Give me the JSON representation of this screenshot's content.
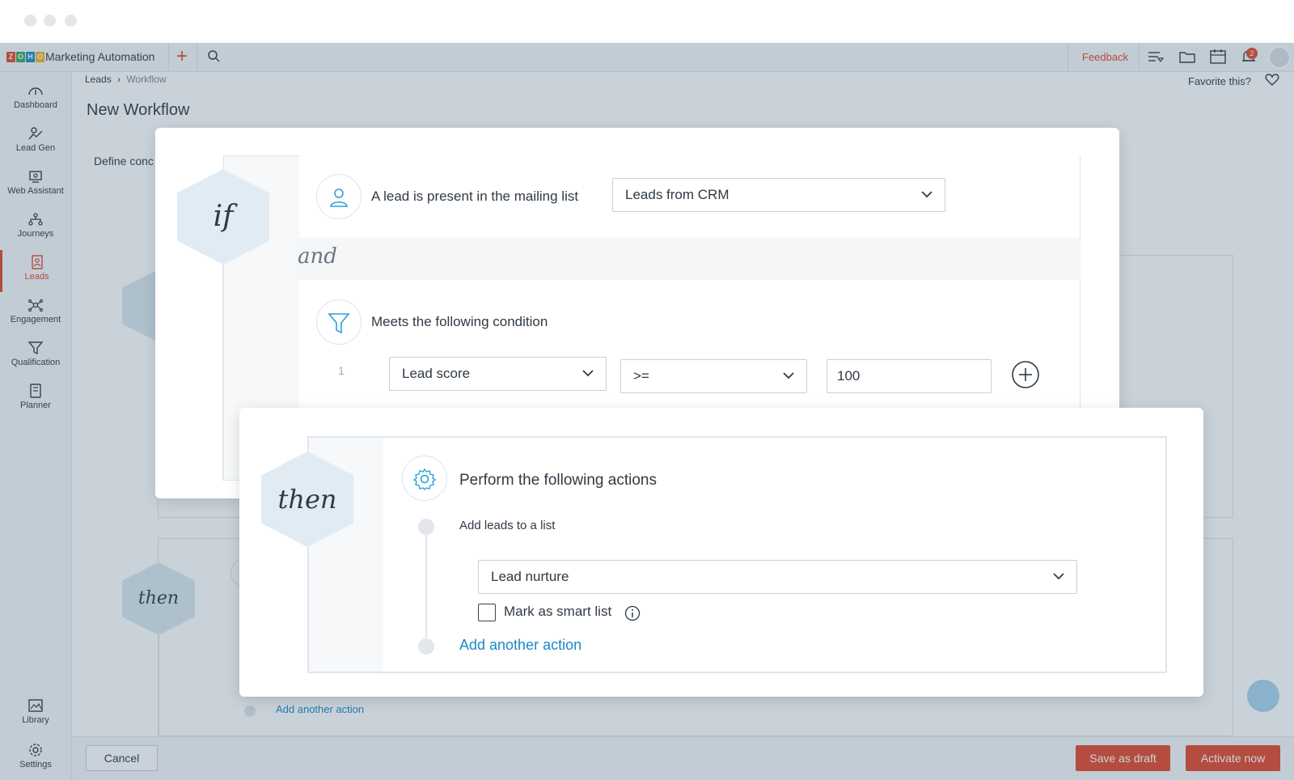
{
  "app": {
    "title": "Marketing Automation",
    "logo_letters": [
      "Z",
      "O",
      "H",
      "O"
    ]
  },
  "topbar": {
    "feedback": "Feedback",
    "notification_count": "2"
  },
  "sidebar": {
    "items": [
      {
        "label": "Dashboard",
        "icon": "dashboard-icon"
      },
      {
        "label": "Lead Gen",
        "icon": "lead-gen-icon"
      },
      {
        "label": "Web Assistant",
        "icon": "web-assistant-icon"
      },
      {
        "label": "Journeys",
        "icon": "journeys-icon"
      },
      {
        "label": "Leads",
        "icon": "leads-icon",
        "active": true
      },
      {
        "label": "Engagement",
        "icon": "engagement-icon"
      },
      {
        "label": "Qualification",
        "icon": "qualification-icon"
      },
      {
        "label": "Planner",
        "icon": "planner-icon"
      }
    ],
    "bottom": [
      {
        "label": "Library",
        "icon": "library-icon"
      },
      {
        "label": "Settings",
        "icon": "settings-icon"
      }
    ]
  },
  "breadcrumb": {
    "parent": "Leads",
    "separator": "›",
    "current": "Workflow"
  },
  "favorite": {
    "label": "Favorite this?"
  },
  "page": {
    "title": "New Workflow",
    "define_text": "Define conc"
  },
  "background": {
    "then_label": "then",
    "add_action": "Add another action"
  },
  "if_card": {
    "hex_label": "if",
    "condition1": {
      "label": "A lead is present in the mailing list",
      "select_value": "Leads from CRM"
    },
    "and_label": "and",
    "condition2": {
      "label": "Meets the following condition",
      "row_number": "1",
      "field": "Lead score",
      "operator": ">=",
      "value": "100"
    }
  },
  "then_card": {
    "hex_label": "then",
    "title": "Perform the following actions",
    "action_label": "Add leads to a list",
    "list_value": "Lead nurture",
    "smart_list_label": "Mark as smart list",
    "add_action": "Add another action"
  },
  "footer": {
    "cancel": "Cancel",
    "save_draft": "Save as draft",
    "activate": "Activate now"
  },
  "colors": {
    "accent": "#e2472c",
    "link": "#1a88c9",
    "hex_bg": "#e1ebf3"
  }
}
